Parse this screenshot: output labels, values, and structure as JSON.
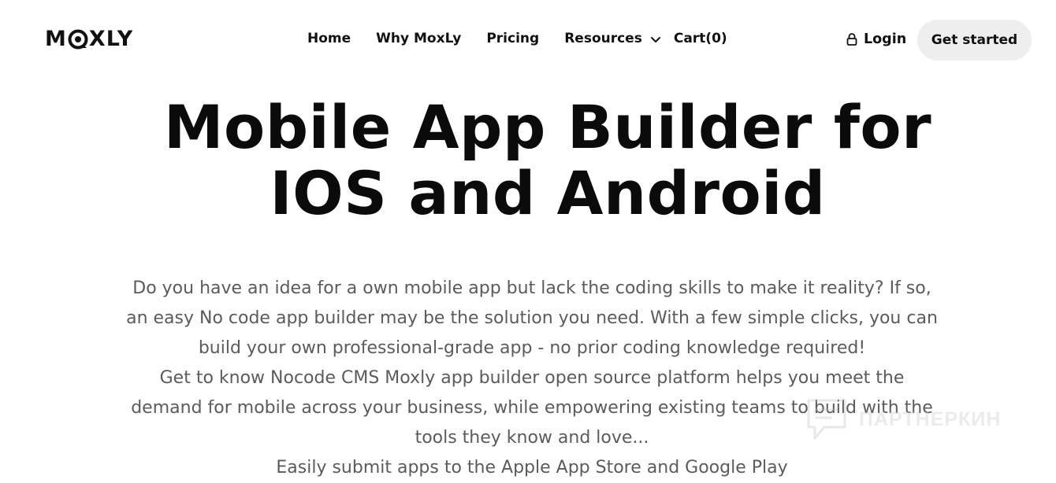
{
  "header": {
    "logo": {
      "left": "M",
      "right": "XLY",
      "mark_color": "#111111"
    },
    "nav": [
      {
        "label": "Home"
      },
      {
        "label": "Why MoxLy"
      },
      {
        "label": "Pricing"
      },
      {
        "label": "Resources",
        "icon": "chevron-down-icon"
      },
      {
        "label": "Cart(0)"
      }
    ],
    "login": {
      "label": "Login",
      "icon": "lock-icon"
    },
    "cta": {
      "label": "Get started",
      "background": "#eeeeee"
    }
  },
  "hero": {
    "title_lines": [
      "Mobile App Builder for",
      "IOS and Android"
    ],
    "body_lines": [
      "Do you have an idea for a own mobile app but lack the coding skills to make it reality? If so,",
      "an easy No code app builder may be the solution you need. With a few simple clicks, you can",
      "build your own professional-grade app - no prior coding knowledge required!",
      "Get to know Nocode CMS Moxly app builder open source platform helps you meet the",
      "demand for mobile across your business, while empowering existing teams to build with the",
      "tools they know and love...",
      "Easily submit apps to the Apple App Store and Google Play"
    ]
  },
  "watermark": {
    "text": "ПАРТНЕРКИН",
    "icon": "chat-bubble-icon"
  }
}
